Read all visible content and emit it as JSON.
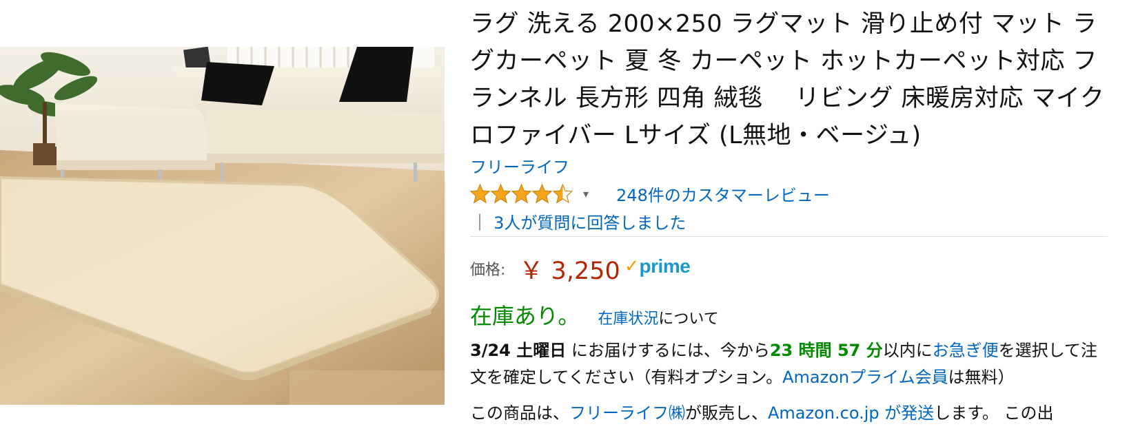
{
  "product": {
    "title": "ラグ 洗える 200×250 ラグマット 滑り止め付 マット ラグカーペット 夏 冬 カーペット ホットカーペット対応 フランネル 長方形 四角 絨毯 　リビング 床暖房対応 マイクロファイバー Lサイズ (L無地・ベージュ)",
    "brand": "フリーライフ",
    "image_alt": "rug-in-living-room"
  },
  "rating": {
    "stars_value": 4.5,
    "stars_max": 5,
    "star_color": "#f7a51b",
    "caret": "▾",
    "reviews_link": "248件のカスタマーレビュー",
    "qa_separator": "|",
    "qa_link": "3人が質問に回答しました"
  },
  "price": {
    "label": "価格:",
    "value": "￥ 3,250",
    "prime_check": "✓",
    "prime_word": "prime"
  },
  "stock": {
    "status": "在庫あり。",
    "info_link": "在庫状況",
    "info_suffix": "について"
  },
  "delivery": {
    "date": "3/24 土曜日",
    "text1": " にお届けするには、今から",
    "countdown": "23 時間 57 分",
    "text2": "以内に",
    "express_link": "お急ぎ便",
    "text3": "を選択して注文を確定してください（有料オプション。",
    "prime_member_link": "Amazonプライム会員",
    "text4": "は無料）"
  },
  "seller": {
    "text1": "この商品は、",
    "seller_link": "フリーライフ㈱",
    "text2": "が販売し、",
    "shipper_link": "Amazon.co.jp が発送",
    "text3": "します。 この出"
  },
  "colors": {
    "link": "#0066c0",
    "price": "#b12704",
    "in_stock": "#008a00",
    "prime": "#1a98c6",
    "prime_check": "#ff9900"
  }
}
